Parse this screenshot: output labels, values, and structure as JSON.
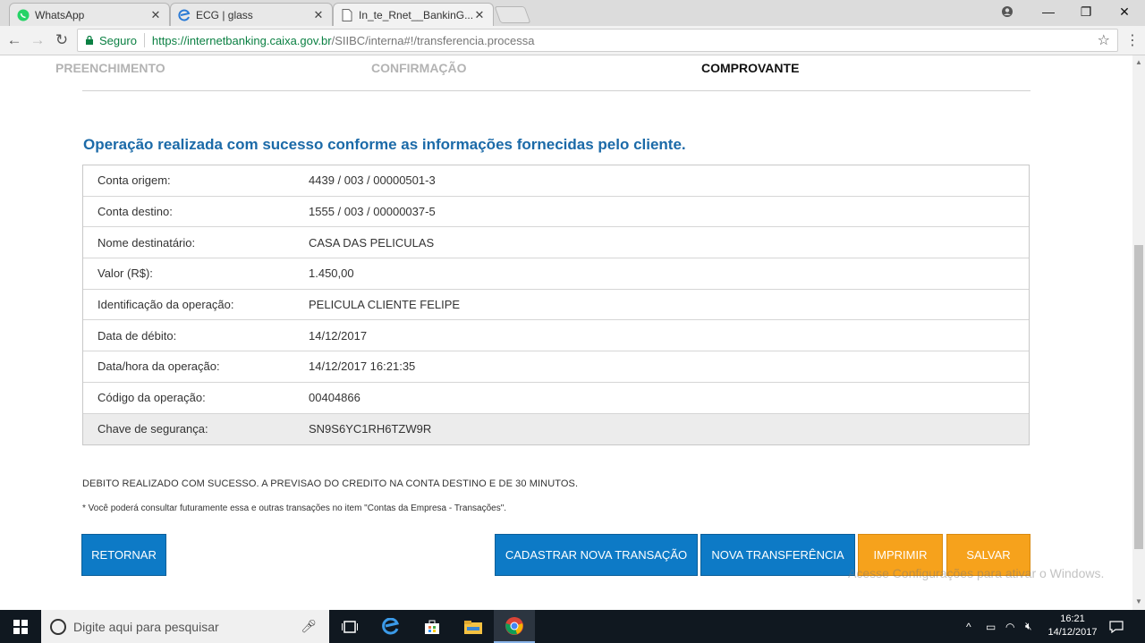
{
  "browser": {
    "tabs": [
      {
        "title": "WhatsApp",
        "icon": "whatsapp-icon"
      },
      {
        "title": "ECG | glass",
        "icon": "edge-e-icon"
      },
      {
        "title": "In_te_Rnet__BankinG...C",
        "icon": "page-icon"
      }
    ],
    "secure_label": "Seguro",
    "url_host": "https://internetbanking.caixa.gov.br",
    "url_path": "/SIIBC/interna#!/transferencia.processa"
  },
  "steps": {
    "step1": "PREENCHIMENTO",
    "step2": "CONFIRMAÇÃO",
    "step3": "COMPROVANTE"
  },
  "success_title": "Operação realizada com sucesso conforme as informações fornecidas pelo cliente.",
  "details": [
    {
      "label": "Conta origem:",
      "value": "4439 / 003 / 00000501-3"
    },
    {
      "label": "Conta destino:",
      "value": "1555 / 003 / 00000037-5"
    },
    {
      "label": "Nome destinatário:",
      "value": "CASA DAS PELICULAS"
    },
    {
      "label": "Valor (R$):",
      "value": "1.450,00"
    },
    {
      "label": "Identificação da operação:",
      "value": "PELICULA CLIENTE FELIPE"
    },
    {
      "label": "Data de débito:",
      "value": "14/12/2017"
    },
    {
      "label": "Data/hora da operação:",
      "value": "14/12/2017 16:21:35"
    },
    {
      "label": "Código da operação:",
      "value": "00404866"
    },
    {
      "label": "Chave de segurança:",
      "value": "SN9S6YC1RH6TZW9R"
    }
  ],
  "notice": "DEBITO REALIZADO COM SUCESSO. A PREVISAO DO CREDITO NA CONTA DESTINO E DE 30 MINUTOS.",
  "footnote": "* Você poderá consultar futuramente essa e outras transações no item \"Contas da Empresa - Transações\".",
  "buttons": {
    "retornar": "RETORNAR",
    "cadastrar": "CADASTRAR NOVA TRANSAÇÃO",
    "nova_transferencia": "NOVA TRANSFERÊNCIA",
    "imprimir": "IMPRIMIR",
    "salvar": "SALVAR"
  },
  "watermark": "Acesse Configurações para ativar o Windows.",
  "taskbar": {
    "search_placeholder": "Digite aqui para pesquisar",
    "time": "16:21",
    "date": "14/12/2017"
  },
  "colors": {
    "accent_blue": "#0d7ac6",
    "accent_orange": "#f6a21c",
    "title_blue": "#1b6aa8",
    "secure_green": "#0b8043"
  }
}
